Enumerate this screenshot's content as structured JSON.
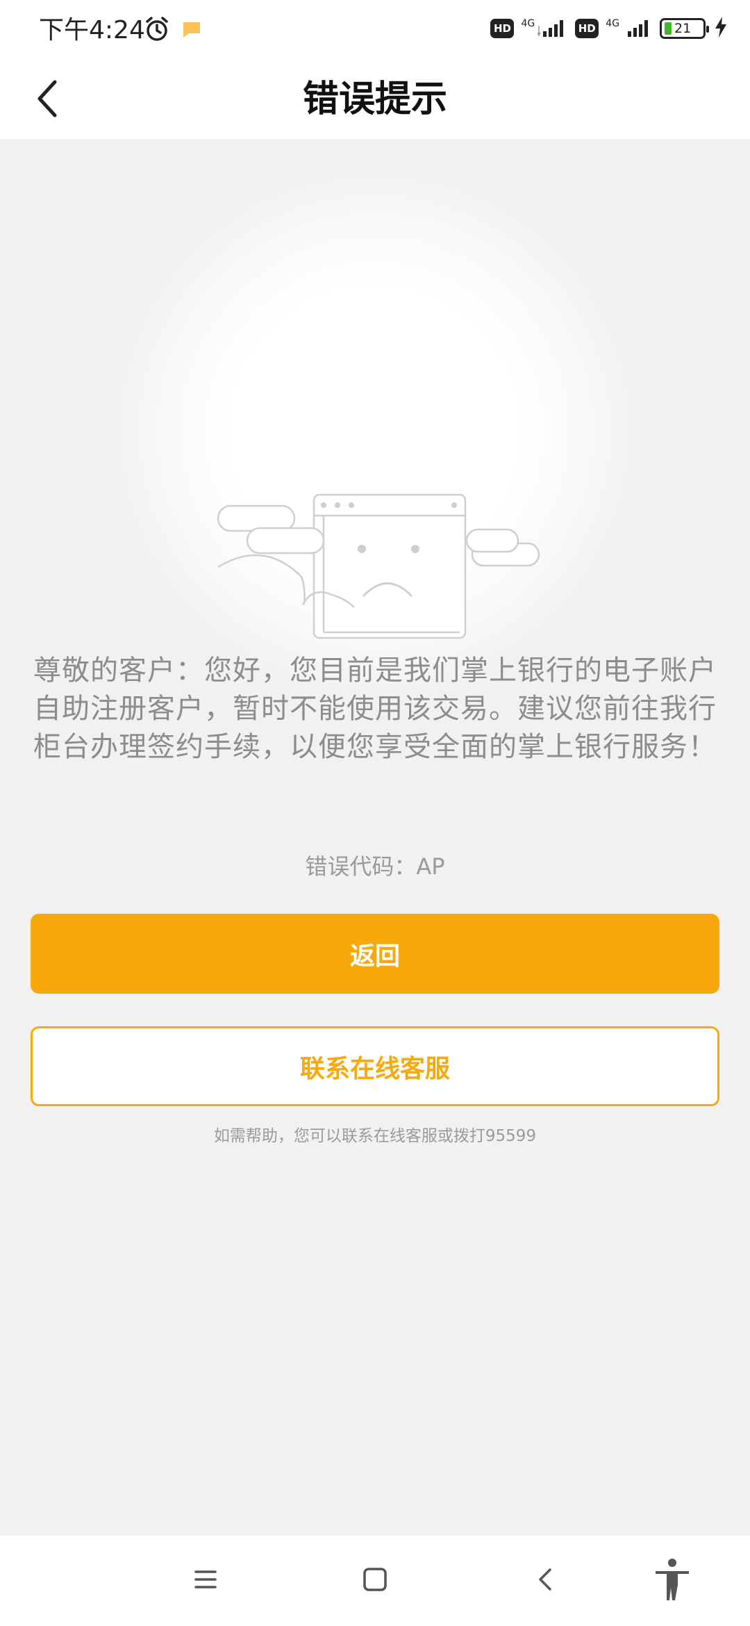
{
  "status_bar": {
    "time": "下午4:24",
    "network_1": "4G",
    "network_2": "4G",
    "hd_1": "HD",
    "hd_2": "HD",
    "battery": "21"
  },
  "header": {
    "title": "错误提示",
    "back_icon": "chevron-left-icon"
  },
  "main": {
    "illustration": "sad-browser-window-illustration",
    "message": "尊敬的客户：您好，您目前是我们掌上银行的电子账户自助注册客户，暂时不能使用该交易。建议您前往我行柜台办理签约手续，以便您享受全面的掌上银行服务！",
    "error_code": "错误代码：AP",
    "primary_button": "返回",
    "secondary_button": "联系在线客服",
    "help_text": "如需帮助，您可以联系在线客服或拨打95599"
  },
  "system_nav": {
    "menu_icon": "menu-icon",
    "home_icon": "home-icon",
    "back_icon": "back-icon",
    "accessibility_icon": "accessibility-icon"
  },
  "colors": {
    "accent": "#f7a80a",
    "background": "#f1f1f1",
    "text_muted": "#8c8c8c"
  }
}
